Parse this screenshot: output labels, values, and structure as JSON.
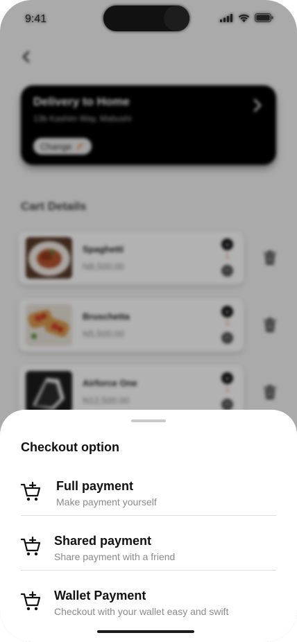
{
  "status_bar": {
    "time": "9:41"
  },
  "delivery": {
    "title": "Delivery to Home",
    "address": "13b Kashim Way, Mabushi",
    "change_label": "Change"
  },
  "cart": {
    "title": "Cart Details",
    "items": [
      {
        "name": "Spaghetti",
        "price": "N8,500.00",
        "quantity": "1"
      },
      {
        "name": "Bruschetta",
        "price": "N5,500.00",
        "quantity": "2"
      },
      {
        "name": "Airforce One",
        "price": "N12,500.00",
        "quantity": "1"
      }
    ]
  },
  "checkout": {
    "title": "Checkout option",
    "options": [
      {
        "title": "Full payment",
        "subtitle": "Make payment yourself",
        "icon": "cart-add-icon"
      },
      {
        "title": "Shared payment",
        "subtitle": "Share payment with a friend",
        "icon": "cart-add-icon"
      },
      {
        "title": "Wallet Payment",
        "subtitle": "Checkout with your wallet easy and swift",
        "icon": "cart-add-icon"
      }
    ]
  },
  "colors": {
    "accent": "#e0653a",
    "card_dark": "#000000",
    "sheet_bg": "#ffffff"
  }
}
